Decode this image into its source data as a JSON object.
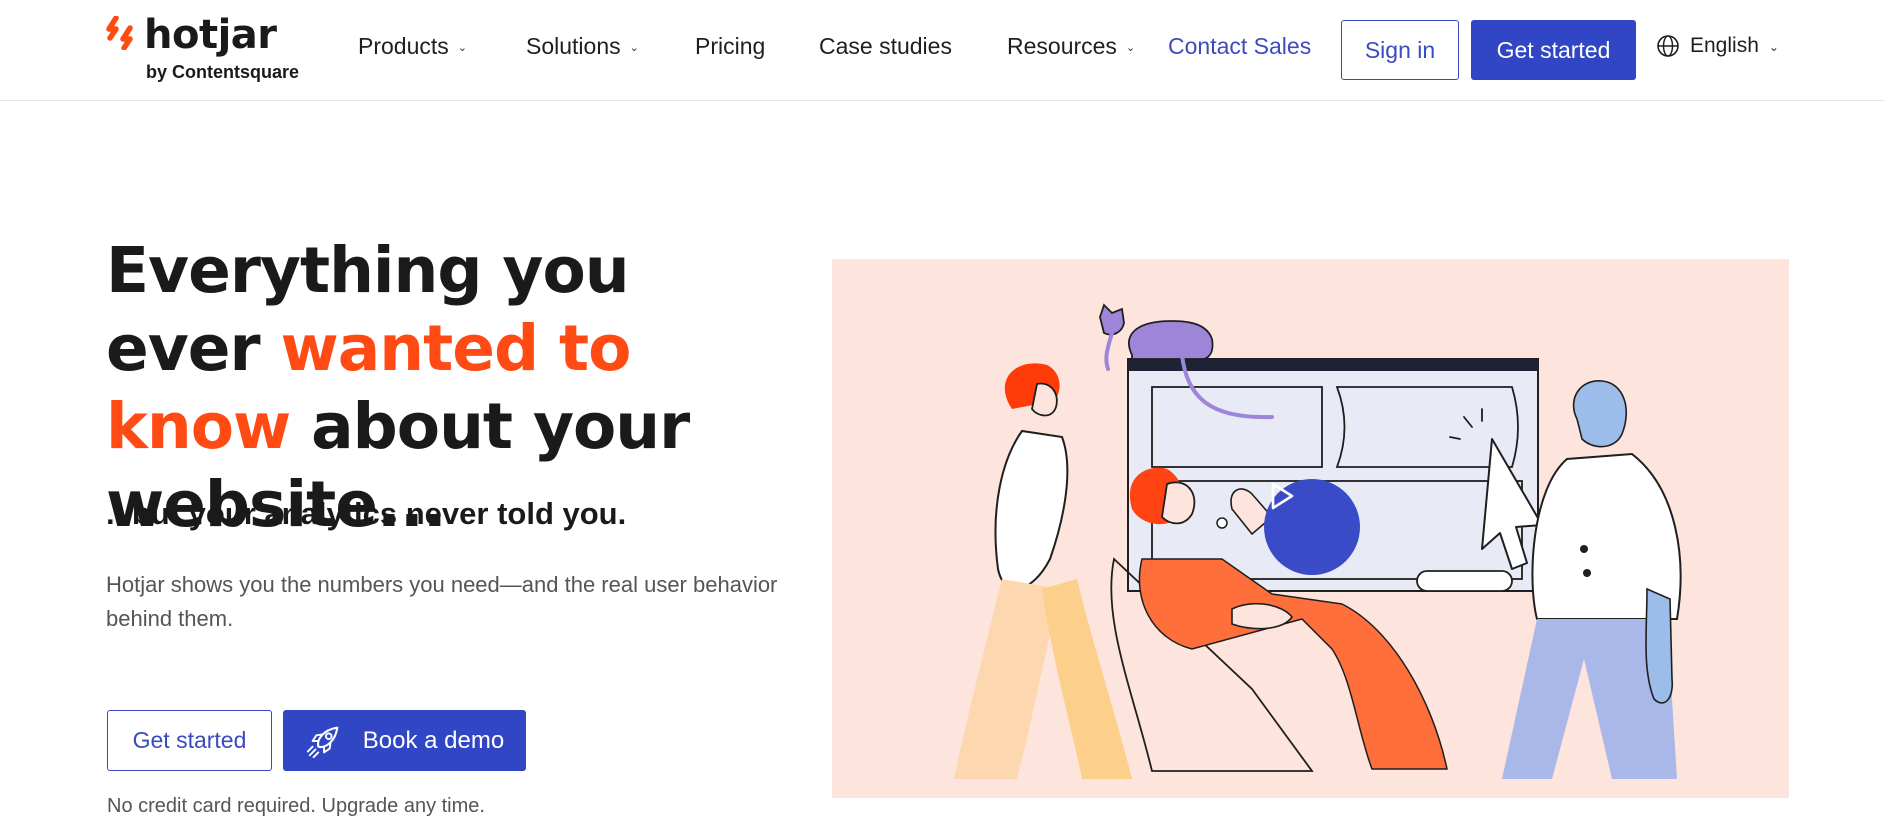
{
  "brand": {
    "name": "hotjar",
    "tagline": "by Contentsquare",
    "accent_color": "#ff4a14",
    "primary_color": "#3046c4"
  },
  "nav": {
    "items": [
      {
        "label": "Products",
        "has_dropdown": true
      },
      {
        "label": "Solutions",
        "has_dropdown": true
      },
      {
        "label": "Pricing",
        "has_dropdown": false
      },
      {
        "label": "Case studies",
        "has_dropdown": false
      },
      {
        "label": "Resources",
        "has_dropdown": true
      }
    ],
    "contact_sales": "Contact Sales",
    "sign_in": "Sign in",
    "get_started": "Get started",
    "language": "English",
    "language_icon": "globe-icon"
  },
  "hero": {
    "headline_pre": "Everything you ever",
    "headline_accent": "wanted to know",
    "headline_post": "about your website...",
    "subheadline": "...but your analytics never told you.",
    "body": "Hotjar shows you the numbers you need—and the real user behavior behind them.",
    "cta_primary": "Get started",
    "cta_demo": "Book a demo",
    "cta_demo_icon": "rocket-icon",
    "note": "No credit card required. Upgrade any time."
  },
  "media": {
    "play_icon": "play-icon",
    "background_color": "#fde4dc"
  }
}
